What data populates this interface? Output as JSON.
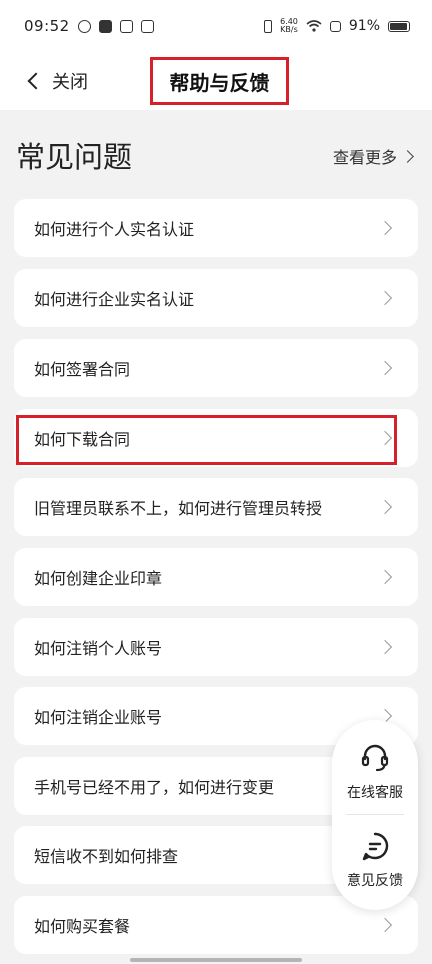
{
  "status_bar": {
    "time": "09:52",
    "net_speed_value": "6.40",
    "net_speed_unit": "KB/s",
    "battery_percent": "91%"
  },
  "top_bar": {
    "back_label": "关闭",
    "title": "帮助与反馈"
  },
  "faq": {
    "title": "常见问题",
    "see_more": "查看更多",
    "items": [
      "如何进行个人实名认证",
      "如何进行企业实名认证",
      "如何签署合同",
      "如何下载合同",
      "旧管理员联系不上，如何进行管理员转授",
      "如何创建企业印章",
      "如何注销个人账号",
      "如何注销企业账号",
      "手机号已经不用了，如何进行变更",
      "短信收不到如何排查",
      "如何购买套餐"
    ]
  },
  "float_panel": {
    "online_service": "在线客服",
    "feedback": "意见反馈"
  },
  "colors": {
    "highlight": "#d6202a",
    "background": "#f2f2f2",
    "card": "#ffffff"
  }
}
